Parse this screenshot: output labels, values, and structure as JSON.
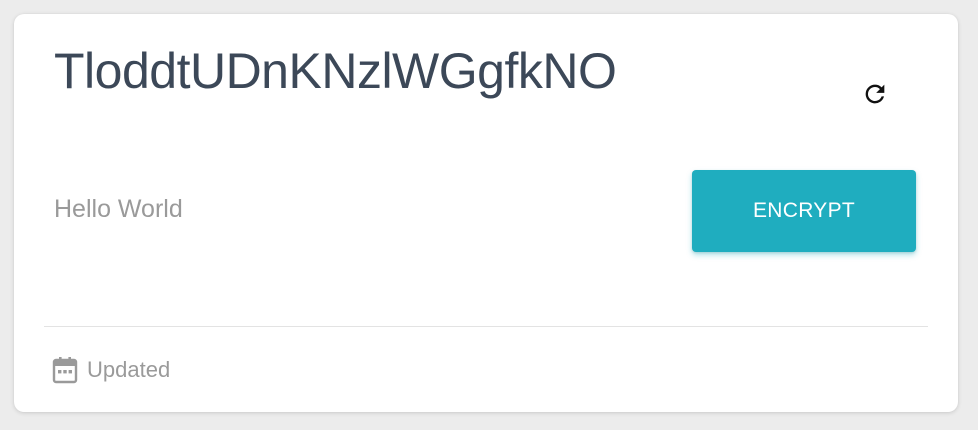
{
  "card": {
    "title": "TloddtUDnKNzlWGgfkNO",
    "refresh_icon": "refresh-icon",
    "input_value": "Hello World",
    "encrypt_label": "ENCRYPT",
    "footer": {
      "icon": "calendar-icon",
      "status": "Updated"
    }
  },
  "colors": {
    "accent": "#1fadbf",
    "title": "#3c4858",
    "muted": "#9a9a9a",
    "background": "#ececec"
  }
}
